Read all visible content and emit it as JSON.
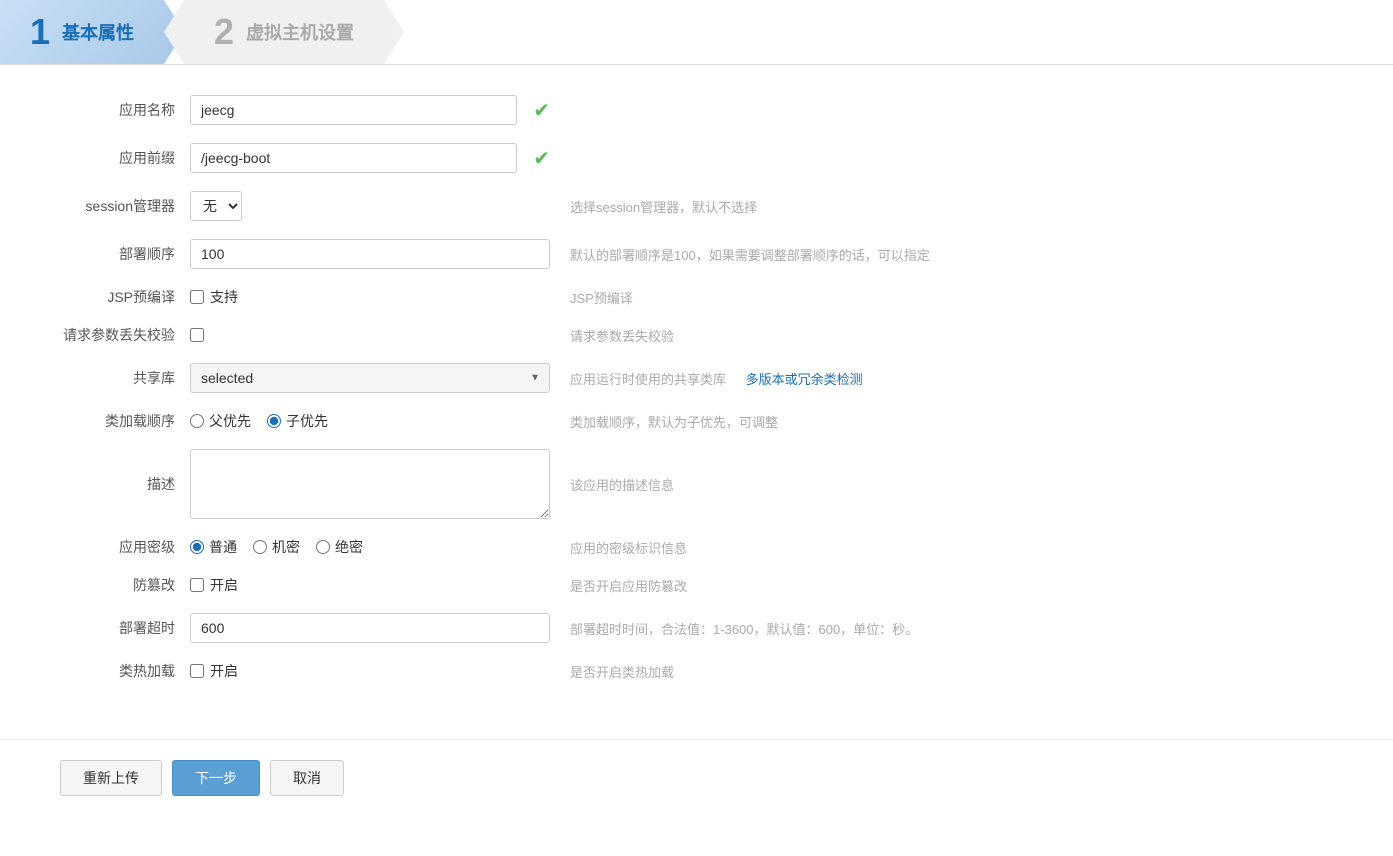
{
  "steps": [
    {
      "number": "1",
      "title": "基本属性",
      "state": "active"
    },
    {
      "number": "2",
      "title": "虚拟主机设置",
      "state": "inactive"
    }
  ],
  "form": {
    "app_name_label": "应用名称",
    "app_name_value": "jeecg",
    "app_prefix_label": "应用前缀",
    "app_prefix_value": "/jeecg-boot",
    "session_manager_label": "session管理器",
    "session_manager_value": "无",
    "session_manager_hint": "选择session管理器，默认不选择",
    "deploy_order_label": "部署顺序",
    "deploy_order_value": "100",
    "deploy_order_hint": "默认的部署顺序是100，如果需要调整部署顺序的话，可以指定",
    "jsp_precompile_label": "JSP预编译",
    "jsp_precompile_checkbox_label": "支持",
    "jsp_precompile_hint": "JSP预编译",
    "request_validate_label": "请求参数丢失校验",
    "request_validate_hint": "请求参数丢失校验",
    "shared_lib_label": "共享库",
    "shared_lib_value": "selected",
    "shared_lib_hint": "应用运行时使用的共享类库",
    "shared_lib_link": "多版本或冗余类检测",
    "class_load_label": "类加载顺序",
    "class_load_option1": "父优先",
    "class_load_option2": "子优先",
    "class_load_hint": "类加载顺序，默认为子优先，可调整",
    "description_label": "描述",
    "description_value": "",
    "description_hint": "该应用的描述信息",
    "security_level_label": "应用密级",
    "security_normal": "普通",
    "security_secret": "机密",
    "security_topsecret": "绝密",
    "security_hint": "应用的密级标识信息",
    "tamper_proof_label": "防篡改",
    "tamper_proof_checkbox_label": "开启",
    "tamper_proof_hint": "是否开启应用防篡改",
    "deploy_timeout_label": "部署超时",
    "deploy_timeout_value": "600",
    "deploy_timeout_hint": "部署超时时间，合法值：1-3600，默认值：600，单位：秒。",
    "hot_reload_label": "类热加载",
    "hot_reload_checkbox_label": "开启",
    "hot_reload_hint": "是否开启类热加载"
  },
  "buttons": {
    "reupload": "重新上传",
    "next": "下一步",
    "cancel": "取消"
  }
}
